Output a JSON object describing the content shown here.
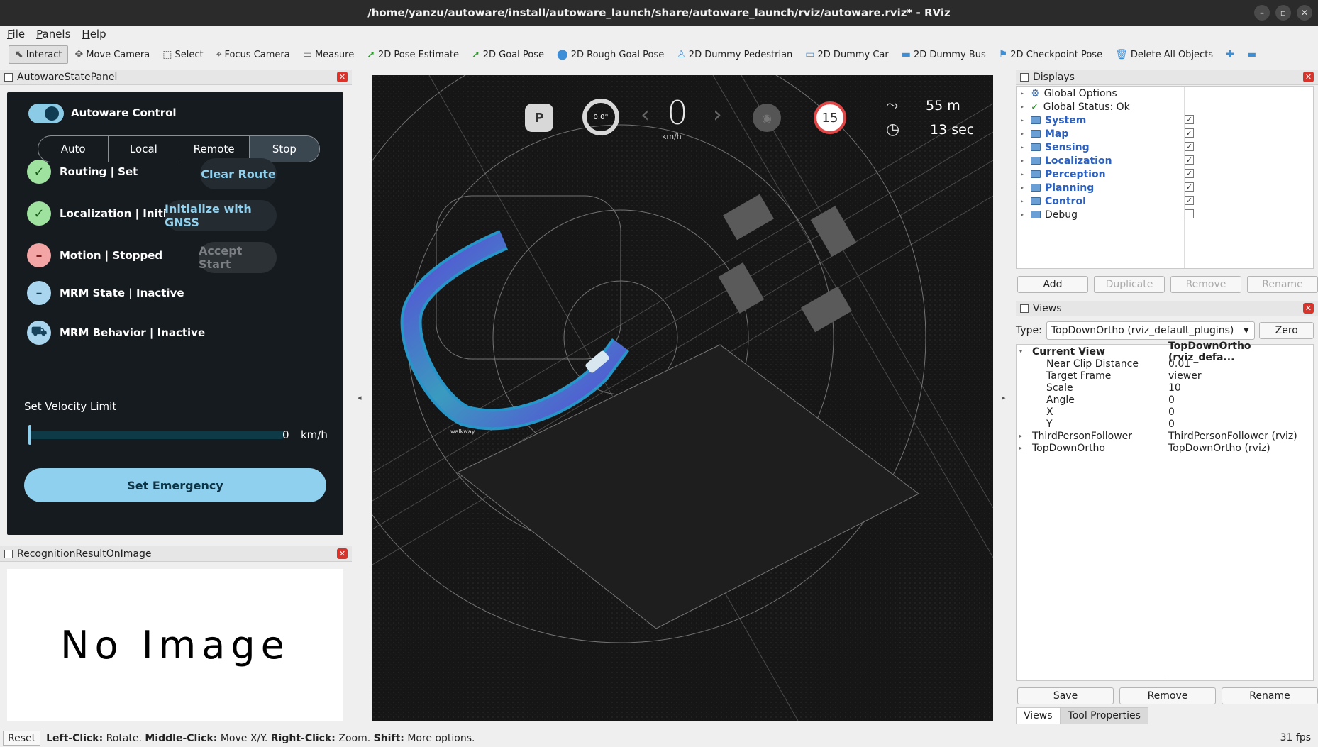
{
  "window": {
    "title": "/home/yanzu/autoware/install/autoware_launch/share/autoware_launch/rviz/autoware.rviz* - RViz"
  },
  "menu": [
    "File",
    "Panels",
    "Help"
  ],
  "toolbar": [
    {
      "label": "Interact",
      "icon": "cursor-icon",
      "active": true
    },
    {
      "label": "Move Camera",
      "icon": "move-icon"
    },
    {
      "label": "Select",
      "icon": "select-icon"
    },
    {
      "label": "Focus Camera",
      "icon": "focus-icon"
    },
    {
      "label": "Measure",
      "icon": "ruler-icon"
    },
    {
      "label": "2D Pose Estimate",
      "icon": "green-arrow-icon"
    },
    {
      "label": "2D Goal Pose",
      "icon": "green-arrow-icon"
    },
    {
      "label": "2D Rough Goal Pose",
      "icon": "pin-icon"
    },
    {
      "label": "2D Dummy Pedestrian",
      "icon": "pedestrian-icon"
    },
    {
      "label": "2D Dummy Car",
      "icon": "car-icon"
    },
    {
      "label": "2D Dummy Bus",
      "icon": "bus-icon"
    },
    {
      "label": "2D Checkpoint Pose",
      "icon": "flag-icon"
    },
    {
      "label": "Delete All Objects",
      "icon": "trash-icon"
    }
  ],
  "state_panel": {
    "title": "AutowareStatePanel",
    "control_label": "Autoware Control",
    "modes": [
      "Auto",
      "Local",
      "Remote",
      "Stop"
    ],
    "selected_mode": "Stop",
    "routing": "Routing | Set",
    "clear_route": "Clear Route",
    "localization": "Localization | Initialized",
    "init_gnss": "Initialize with GNSS",
    "motion": "Motion | Stopped",
    "accept_start": "Accept Start",
    "mrm_state": "MRM State | Inactive",
    "mrm_behavior": "MRM Behavior | Inactive",
    "velocity_label": "Set Velocity Limit",
    "velocity_value": "0",
    "velocity_unit": "km/h",
    "emergency": "Set Emergency"
  },
  "recognition_panel": {
    "title": "RecognitionResultOnImage",
    "placeholder": "No Image"
  },
  "hud": {
    "gear": "P",
    "steering": "0.0°",
    "speed": "0",
    "speed_unit": "km/h",
    "speed_limit": "15",
    "distance": "55 m",
    "time": "13 sec"
  },
  "map_label": "walkway",
  "displays": {
    "title": "Displays",
    "items": [
      {
        "label": "Global Options",
        "icon": "gear-icon",
        "bold": false,
        "checked": null
      },
      {
        "label": "Global Status: Ok",
        "icon": "check-icon",
        "bold": false,
        "checked": null
      },
      {
        "label": "System",
        "icon": "folder-icon",
        "bold": true,
        "checked": true
      },
      {
        "label": "Map",
        "icon": "folder-icon",
        "bold": true,
        "checked": true
      },
      {
        "label": "Sensing",
        "icon": "folder-icon",
        "bold": true,
        "checked": true
      },
      {
        "label": "Localization",
        "icon": "folder-icon",
        "bold": true,
        "checked": true
      },
      {
        "label": "Perception",
        "icon": "folder-icon",
        "bold": true,
        "checked": true
      },
      {
        "label": "Planning",
        "icon": "folder-icon",
        "bold": true,
        "checked": true
      },
      {
        "label": "Control",
        "icon": "folder-icon",
        "bold": true,
        "checked": true
      },
      {
        "label": "Debug",
        "icon": "folder-icon",
        "bold": false,
        "checked": false
      }
    ],
    "buttons": [
      "Add",
      "Duplicate",
      "Remove",
      "Rename"
    ]
  },
  "views": {
    "title": "Views",
    "type_label": "Type:",
    "type_value": "TopDownOrtho (rviz_default_plugins)",
    "zero": "Zero",
    "current_view": {
      "name": "Current View",
      "value": "TopDownOrtho (rviz_defa..."
    },
    "properties": [
      {
        "name": "Near Clip Distance",
        "value": "0.01"
      },
      {
        "name": "Target Frame",
        "value": "viewer"
      },
      {
        "name": "Scale",
        "value": "10"
      },
      {
        "name": "Angle",
        "value": "0"
      },
      {
        "name": "X",
        "value": "0"
      },
      {
        "name": "Y",
        "value": "0"
      }
    ],
    "saved": [
      {
        "name": "ThirdPersonFollower",
        "value": "ThirdPersonFollower (rviz)"
      },
      {
        "name": "TopDownOrtho",
        "value": "TopDownOrtho (rviz)"
      }
    ],
    "buttons": [
      "Save",
      "Remove",
      "Rename"
    ]
  },
  "bottom_tabs": [
    "Views",
    "Tool Properties"
  ],
  "status": {
    "reset": "Reset",
    "hint_lc": "Left-Click:",
    "hint_lc_t": "Rotate.",
    "hint_mc": "Middle-Click:",
    "hint_mc_t": "Move X/Y.",
    "hint_rc": "Right-Click:",
    "hint_rc_t": "Zoom.",
    "hint_sh": "Shift:",
    "hint_sh_t": "More options.",
    "fps": "31 fps"
  }
}
